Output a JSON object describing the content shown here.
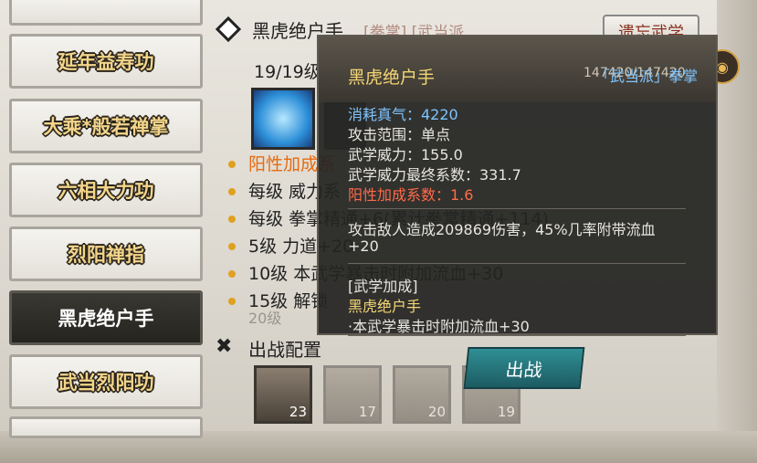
{
  "skill_list": [
    {
      "label": "延年益寿功",
      "active": false
    },
    {
      "label": "大乘*般若禅掌",
      "active": false
    },
    {
      "label": "六相大力功",
      "active": false
    },
    {
      "label": "烈阳禅指",
      "active": false
    },
    {
      "label": "黑虎绝户手",
      "active": true
    },
    {
      "label": "武当烈阳功",
      "active": false
    }
  ],
  "detail": {
    "title": "黑虎绝户手",
    "tags": "[拳掌] [武当派",
    "forget_button": "遗忘武学",
    "level": "19/19级",
    "exp": "147420/147420",
    "rows": [
      {
        "text": "阳性加成系",
        "style": "orange"
      },
      {
        "text": "每级  威力系",
        "extra": "力系数+176.7)"
      },
      {
        "text": "每级  拳掌精通+6(累计拳掌精通+114)"
      },
      {
        "text": "  5级  力道+20"
      },
      {
        "text": "10级  本武学暴击时附加流血+30"
      },
      {
        "text": "15级  解锁",
        "extra": "威"
      },
      {
        "text": "20级",
        "style": "faded"
      }
    ],
    "lineup_title": "出战配置",
    "lineup_slots": [
      {
        "num": "23",
        "dim": false
      },
      {
        "num": "17",
        "dim": true
      },
      {
        "num": "20",
        "dim": true
      },
      {
        "num": "19",
        "dim": true
      }
    ]
  },
  "tooltip": {
    "name": "黑虎绝户手",
    "school": "「武当派」拳掌",
    "stats": [
      {
        "text": "消耗真气：4220",
        "style": "blue"
      },
      {
        "text": "攻击范围：单点",
        "style": "normal"
      },
      {
        "text": "武学威力：155.0",
        "style": "normal"
      },
      {
        "text": "武学威力最终系数：331.7",
        "style": "normal"
      },
      {
        "text": "阳性加成系数：1.6",
        "style": "red"
      }
    ],
    "effect_line1": "攻击敌人造成209869伤害，45%几率附带流血",
    "effect_line2": "+20",
    "bonus_header": "[武学加成]",
    "bonus_skill": "黑虎绝户手",
    "bonus_effect": "·本武学暴击时附加流血+30",
    "deploy_button": "出战"
  }
}
